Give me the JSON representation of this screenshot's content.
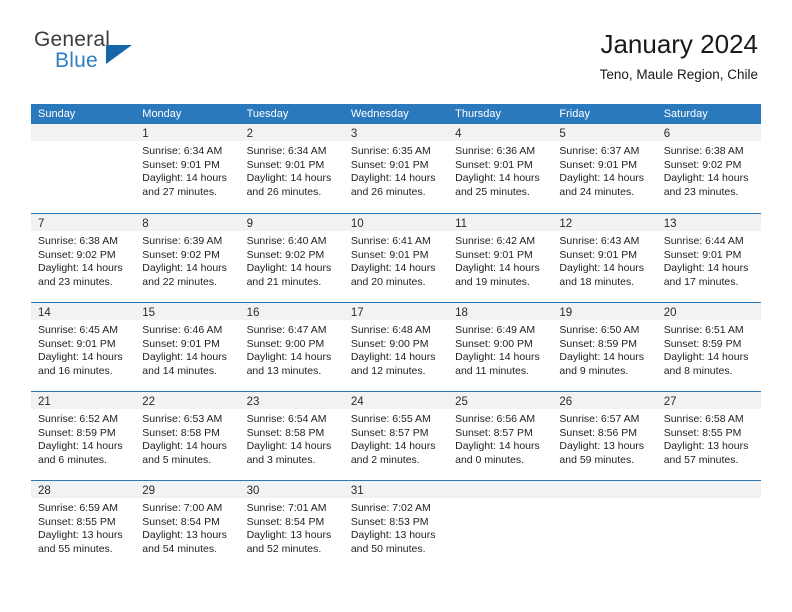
{
  "brand": {
    "line1": "General",
    "line2": "Blue",
    "triangle_color": "#1565a8",
    "blue_color": "#2f7fc4"
  },
  "header": {
    "title": "January 2024",
    "subtitle": "Teno, Maule Region, Chile"
  },
  "theme": {
    "header_bar_color": "#2b79bd",
    "day_band_color": "#f2f2f2",
    "separator_color": "#2b79bd"
  },
  "weekdays": [
    "Sunday",
    "Monday",
    "Tuesday",
    "Wednesday",
    "Thursday",
    "Friday",
    "Saturday"
  ],
  "weeks": [
    [
      {
        "day": "",
        "sunrise": "",
        "sunset": "",
        "daylight1": "",
        "daylight2": ""
      },
      {
        "day": "1",
        "sunrise": "Sunrise: 6:34 AM",
        "sunset": "Sunset: 9:01 PM",
        "daylight1": "Daylight: 14 hours",
        "daylight2": "and 27 minutes."
      },
      {
        "day": "2",
        "sunrise": "Sunrise: 6:34 AM",
        "sunset": "Sunset: 9:01 PM",
        "daylight1": "Daylight: 14 hours",
        "daylight2": "and 26 minutes."
      },
      {
        "day": "3",
        "sunrise": "Sunrise: 6:35 AM",
        "sunset": "Sunset: 9:01 PM",
        "daylight1": "Daylight: 14 hours",
        "daylight2": "and 26 minutes."
      },
      {
        "day": "4",
        "sunrise": "Sunrise: 6:36 AM",
        "sunset": "Sunset: 9:01 PM",
        "daylight1": "Daylight: 14 hours",
        "daylight2": "and 25 minutes."
      },
      {
        "day": "5",
        "sunrise": "Sunrise: 6:37 AM",
        "sunset": "Sunset: 9:01 PM",
        "daylight1": "Daylight: 14 hours",
        "daylight2": "and 24 minutes."
      },
      {
        "day": "6",
        "sunrise": "Sunrise: 6:38 AM",
        "sunset": "Sunset: 9:02 PM",
        "daylight1": "Daylight: 14 hours",
        "daylight2": "and 23 minutes."
      }
    ],
    [
      {
        "day": "7",
        "sunrise": "Sunrise: 6:38 AM",
        "sunset": "Sunset: 9:02 PM",
        "daylight1": "Daylight: 14 hours",
        "daylight2": "and 23 minutes."
      },
      {
        "day": "8",
        "sunrise": "Sunrise: 6:39 AM",
        "sunset": "Sunset: 9:02 PM",
        "daylight1": "Daylight: 14 hours",
        "daylight2": "and 22 minutes."
      },
      {
        "day": "9",
        "sunrise": "Sunrise: 6:40 AM",
        "sunset": "Sunset: 9:02 PM",
        "daylight1": "Daylight: 14 hours",
        "daylight2": "and 21 minutes."
      },
      {
        "day": "10",
        "sunrise": "Sunrise: 6:41 AM",
        "sunset": "Sunset: 9:01 PM",
        "daylight1": "Daylight: 14 hours",
        "daylight2": "and 20 minutes."
      },
      {
        "day": "11",
        "sunrise": "Sunrise: 6:42 AM",
        "sunset": "Sunset: 9:01 PM",
        "daylight1": "Daylight: 14 hours",
        "daylight2": "and 19 minutes."
      },
      {
        "day": "12",
        "sunrise": "Sunrise: 6:43 AM",
        "sunset": "Sunset: 9:01 PM",
        "daylight1": "Daylight: 14 hours",
        "daylight2": "and 18 minutes."
      },
      {
        "day": "13",
        "sunrise": "Sunrise: 6:44 AM",
        "sunset": "Sunset: 9:01 PM",
        "daylight1": "Daylight: 14 hours",
        "daylight2": "and 17 minutes."
      }
    ],
    [
      {
        "day": "14",
        "sunrise": "Sunrise: 6:45 AM",
        "sunset": "Sunset: 9:01 PM",
        "daylight1": "Daylight: 14 hours",
        "daylight2": "and 16 minutes."
      },
      {
        "day": "15",
        "sunrise": "Sunrise: 6:46 AM",
        "sunset": "Sunset: 9:01 PM",
        "daylight1": "Daylight: 14 hours",
        "daylight2": "and 14 minutes."
      },
      {
        "day": "16",
        "sunrise": "Sunrise: 6:47 AM",
        "sunset": "Sunset: 9:00 PM",
        "daylight1": "Daylight: 14 hours",
        "daylight2": "and 13 minutes."
      },
      {
        "day": "17",
        "sunrise": "Sunrise: 6:48 AM",
        "sunset": "Sunset: 9:00 PM",
        "daylight1": "Daylight: 14 hours",
        "daylight2": "and 12 minutes."
      },
      {
        "day": "18",
        "sunrise": "Sunrise: 6:49 AM",
        "sunset": "Sunset: 9:00 PM",
        "daylight1": "Daylight: 14 hours",
        "daylight2": "and 11 minutes."
      },
      {
        "day": "19",
        "sunrise": "Sunrise: 6:50 AM",
        "sunset": "Sunset: 8:59 PM",
        "daylight1": "Daylight: 14 hours",
        "daylight2": "and 9 minutes."
      },
      {
        "day": "20",
        "sunrise": "Sunrise: 6:51 AM",
        "sunset": "Sunset: 8:59 PM",
        "daylight1": "Daylight: 14 hours",
        "daylight2": "and 8 minutes."
      }
    ],
    [
      {
        "day": "21",
        "sunrise": "Sunrise: 6:52 AM",
        "sunset": "Sunset: 8:59 PM",
        "daylight1": "Daylight: 14 hours",
        "daylight2": "and 6 minutes."
      },
      {
        "day": "22",
        "sunrise": "Sunrise: 6:53 AM",
        "sunset": "Sunset: 8:58 PM",
        "daylight1": "Daylight: 14 hours",
        "daylight2": "and 5 minutes."
      },
      {
        "day": "23",
        "sunrise": "Sunrise: 6:54 AM",
        "sunset": "Sunset: 8:58 PM",
        "daylight1": "Daylight: 14 hours",
        "daylight2": "and 3 minutes."
      },
      {
        "day": "24",
        "sunrise": "Sunrise: 6:55 AM",
        "sunset": "Sunset: 8:57 PM",
        "daylight1": "Daylight: 14 hours",
        "daylight2": "and 2 minutes."
      },
      {
        "day": "25",
        "sunrise": "Sunrise: 6:56 AM",
        "sunset": "Sunset: 8:57 PM",
        "daylight1": "Daylight: 14 hours",
        "daylight2": "and 0 minutes."
      },
      {
        "day": "26",
        "sunrise": "Sunrise: 6:57 AM",
        "sunset": "Sunset: 8:56 PM",
        "daylight1": "Daylight: 13 hours",
        "daylight2": "and 59 minutes."
      },
      {
        "day": "27",
        "sunrise": "Sunrise: 6:58 AM",
        "sunset": "Sunset: 8:55 PM",
        "daylight1": "Daylight: 13 hours",
        "daylight2": "and 57 minutes."
      }
    ],
    [
      {
        "day": "28",
        "sunrise": "Sunrise: 6:59 AM",
        "sunset": "Sunset: 8:55 PM",
        "daylight1": "Daylight: 13 hours",
        "daylight2": "and 55 minutes."
      },
      {
        "day": "29",
        "sunrise": "Sunrise: 7:00 AM",
        "sunset": "Sunset: 8:54 PM",
        "daylight1": "Daylight: 13 hours",
        "daylight2": "and 54 minutes."
      },
      {
        "day": "30",
        "sunrise": "Sunrise: 7:01 AM",
        "sunset": "Sunset: 8:54 PM",
        "daylight1": "Daylight: 13 hours",
        "daylight2": "and 52 minutes."
      },
      {
        "day": "31",
        "sunrise": "Sunrise: 7:02 AM",
        "sunset": "Sunset: 8:53 PM",
        "daylight1": "Daylight: 13 hours",
        "daylight2": "and 50 minutes."
      },
      {
        "day": "",
        "sunrise": "",
        "sunset": "",
        "daylight1": "",
        "daylight2": ""
      },
      {
        "day": "",
        "sunrise": "",
        "sunset": "",
        "daylight1": "",
        "daylight2": ""
      },
      {
        "day": "",
        "sunrise": "",
        "sunset": "",
        "daylight1": "",
        "daylight2": ""
      }
    ]
  ]
}
